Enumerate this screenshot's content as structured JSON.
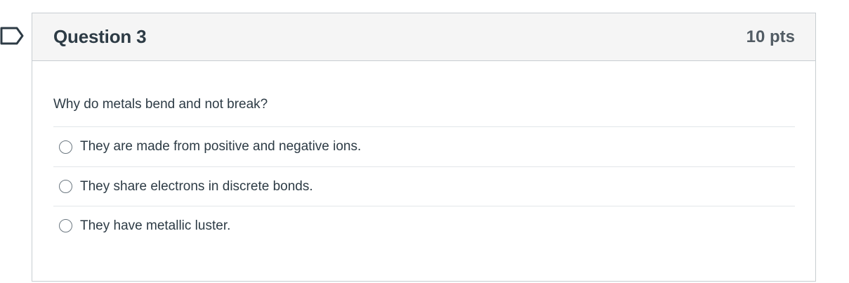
{
  "question": {
    "title": "Question 3",
    "points": "10 pts",
    "text": "Why do metals bend and not break?",
    "answers": [
      {
        "label": "They are made from positive and negative ions."
      },
      {
        "label": "They share electrons in discrete bonds."
      },
      {
        "label": "They have metallic luster."
      }
    ]
  },
  "icons": {
    "flag": "flag-question-icon"
  },
  "colors": {
    "header_background": "#f5f5f5",
    "border": "#c7cdd1",
    "text": "#2d3b45",
    "points_text": "#525c64"
  }
}
